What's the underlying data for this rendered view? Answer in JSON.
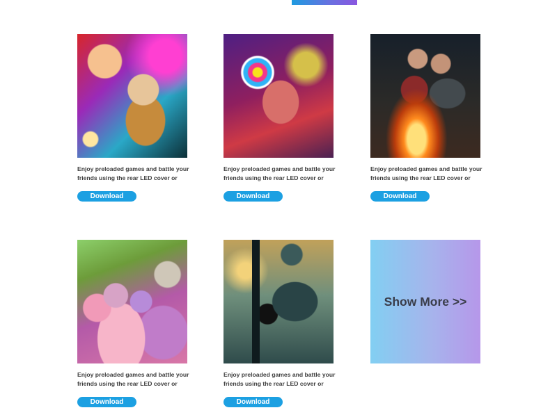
{
  "cards": [
    {
      "caption": "Enjoy preloaded games and battle your friends using the rear LED cover or",
      "button_label": "Download",
      "image_alt": "friends-gaming-photo"
    },
    {
      "caption": "Enjoy preloaded games and battle your friends using the rear LED cover or",
      "button_label": "Download",
      "image_alt": "woman-lollipop-photo"
    },
    {
      "caption": "Enjoy preloaded games and battle your friends using the rear LED cover or",
      "button_label": "Download",
      "image_alt": "campfire-friends-photo"
    },
    {
      "caption": "Enjoy preloaded games and battle your friends using the rear LED cover or",
      "button_label": "Download",
      "image_alt": "holi-festival-photo"
    },
    {
      "caption": "Enjoy preloaded games and battle your friends using the rear LED cover or",
      "button_label": "Download",
      "image_alt": "film-camera-photo"
    }
  ],
  "show_more": {
    "label": "Show More >>"
  },
  "colors": {
    "button_blue": "#1ca0e2",
    "caption_text": "#3e3e3e",
    "show_more_gradient_start": "#82cff2",
    "show_more_gradient_end": "#b697ea"
  }
}
